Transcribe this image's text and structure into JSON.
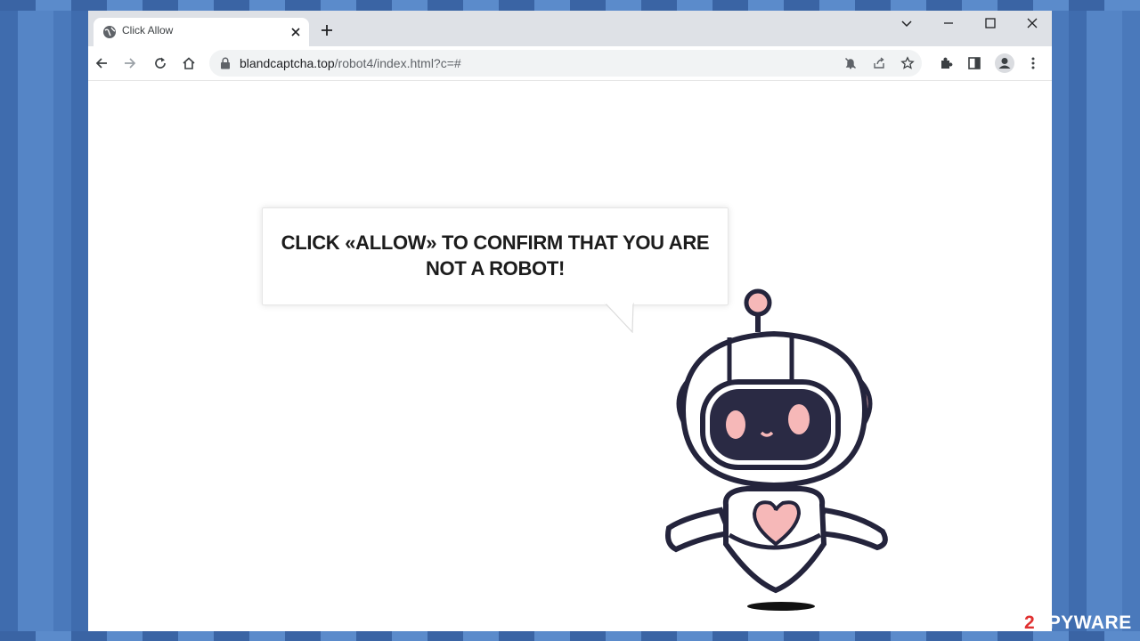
{
  "browser": {
    "tab": {
      "title": "Click Allow"
    },
    "omnibox": {
      "domain": "blandcaptcha.top",
      "path": "/robot4/index.html?c=#"
    }
  },
  "page": {
    "bubble_text": "CLICK «ALLOW» TO CONFIRM THAT YOU ARE NOT A ROBOT!"
  },
  "watermark": {
    "prefix": "2",
    "text": "SPYWAR",
    "suffix": "E"
  },
  "colors": {
    "robot_outline": "#24243c",
    "robot_pink": "#f6b8b8",
    "visor": "#2a2a44"
  },
  "icons": {
    "favicon": "globe-icon",
    "tab_close": "close-icon",
    "new_tab": "plus-icon",
    "back": "arrow-left-icon",
    "forward": "arrow-right-icon",
    "reload": "reload-icon",
    "home": "home-icon",
    "lock": "lock-icon",
    "notifications": "bell-off-icon",
    "share": "share-icon",
    "bookmark": "star-icon",
    "extensions": "puzzle-icon",
    "side_panel": "side-panel-icon",
    "profile": "person-icon",
    "menu": "kebab-menu-icon"
  }
}
